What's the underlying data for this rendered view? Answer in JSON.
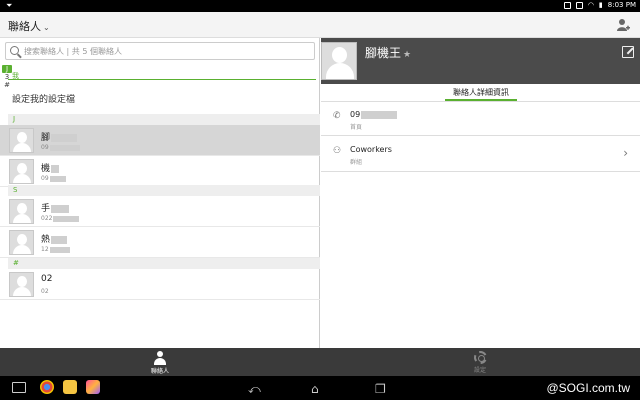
{
  "statusbar": {
    "time": "8:03 PM"
  },
  "appbar": {
    "title": "聯絡人"
  },
  "search": {
    "placeholder": "搜索聯絡人 | 共 5 個聯絡人"
  },
  "index": [
    "J",
    "3",
    "#"
  ],
  "me": {
    "section": "我",
    "my_profile": "設定我的設定檔"
  },
  "sections": [
    {
      "label": "J",
      "contacts": [
        {
          "name": "腳",
          "sub": "09"
        },
        {
          "name": "機",
          "sub": "09"
        }
      ]
    },
    {
      "label": "S",
      "contacts": [
        {
          "name": "手",
          "sub": "022"
        },
        {
          "name": "熱",
          "sub": "12"
        }
      ]
    },
    {
      "label": "#",
      "contacts": [
        {
          "name": "02",
          "sub": "02"
        }
      ]
    }
  ],
  "detail": {
    "name": "腳機王",
    "tab": "聯絡人詳細資訊",
    "phone": {
      "value": "09",
      "type": "首頁"
    },
    "group": {
      "value": "Coworkers",
      "type": "群組"
    }
  },
  "bottomnav": {
    "contacts": "聯絡人",
    "settings": "設定"
  },
  "watermark": "@SOGI.com.tw",
  "colors": {
    "accent": "#5ab030",
    "bar": "#3a3a3a"
  }
}
